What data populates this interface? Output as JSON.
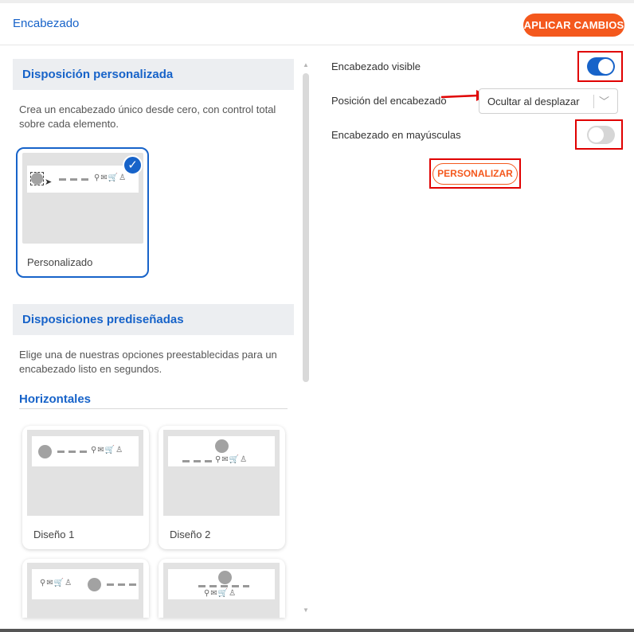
{
  "header": {
    "title": "Encabezado",
    "apply_label": "APLICAR CAMBIOS"
  },
  "left": {
    "custom_section": {
      "title": "Disposición personalizada",
      "description": "Crea un encabezado único desde cero, con control total sobre cada elemento.",
      "card_label": "Personalizado",
      "selected": true
    },
    "preset_section": {
      "title": "Disposiciones prediseñadas",
      "description": "Elige una de nuestras opciones preestablecidas para un encabezado listo en segundos.",
      "group_title": "Horizontales",
      "designs": [
        {
          "label": "Diseño 1"
        },
        {
          "label": "Diseño 2"
        },
        {
          "label": ""
        },
        {
          "label": ""
        }
      ]
    },
    "header_icons": "⚲✉🛒♙"
  },
  "right": {
    "visible": {
      "label": "Encabezado visible",
      "on": true
    },
    "position": {
      "label": "Posición del encabezado",
      "value": "Ocultar al desplazar"
    },
    "uppercase": {
      "label": "Encabezado en mayúsculas",
      "on": false
    },
    "customize_label": "PERSONALIZAR"
  },
  "colors": {
    "accent_blue": "#1763c9",
    "accent_orange": "#f4581d",
    "annotation_red": "#e00000",
    "toggle_off": "#d6d6d6"
  }
}
